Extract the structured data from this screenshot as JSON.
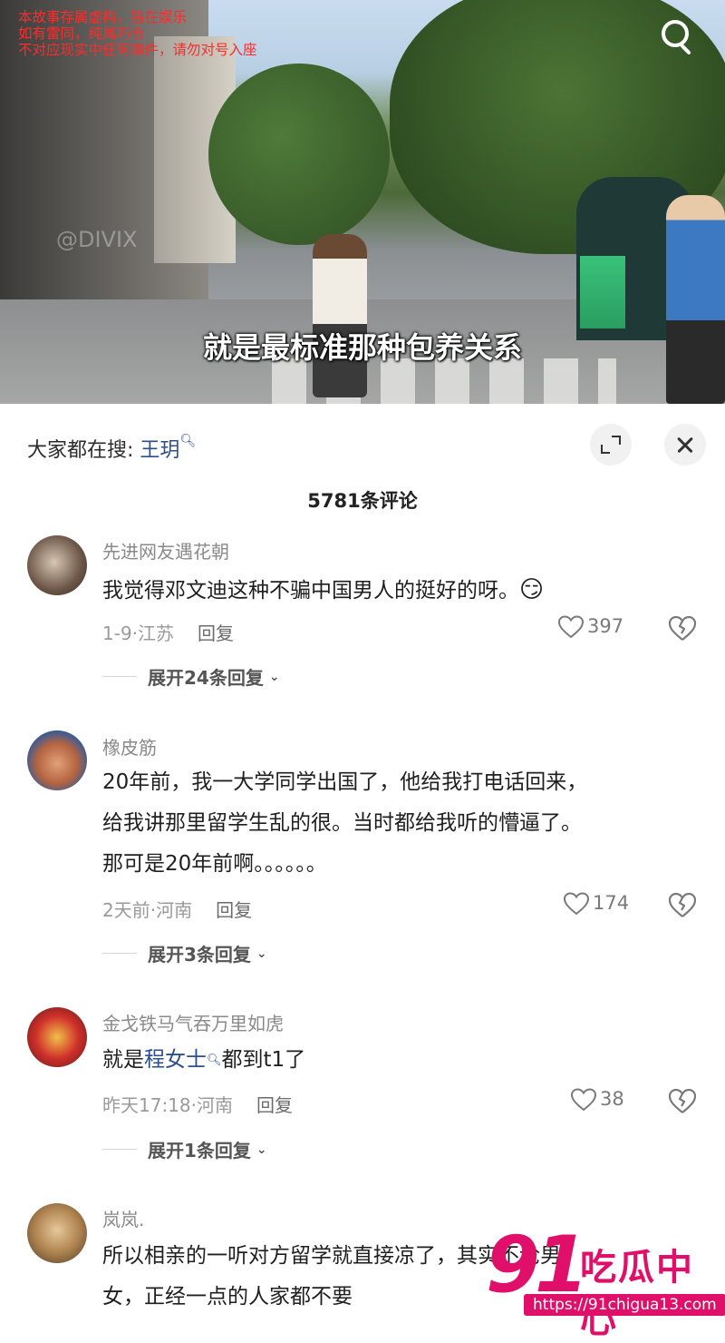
{
  "video": {
    "disclaimer": [
      "本故事存属虚构，旨在娱乐",
      "如有雷同，纯属巧合",
      "不对应现实中任何事件，请勿对号入座"
    ],
    "watermark": "@DIVIX",
    "subtitle": "就是最标准那种包养关系"
  },
  "panel": {
    "hot_search_prefix": "大家都在搜:",
    "hot_search_keyword": "王玥",
    "comment_count": "5781条评论"
  },
  "comments": [
    {
      "username": "先进网友遇花朝",
      "text": "我觉得邓文迪这种不骗中国男人的挺好的呀。",
      "emoji": "😏",
      "meta": "1-9·江苏",
      "reply": "回复",
      "likes": "397",
      "expand": "展开24条回复"
    },
    {
      "username": "橡皮筋",
      "text_lines": [
        "20年前，我一大学同学出国了，他给我打电话回来，",
        "给我讲那里留学生乱的很。当时都给我听的懵逼了。",
        "那可是20年前啊。。。。。。"
      ],
      "meta": "2天前·河南",
      "reply": "回复",
      "likes": "174",
      "expand": "展开3条回复"
    },
    {
      "username": "金戈铁马气吞万里如虎",
      "text_before": "就是",
      "text_keyword": "程女士",
      "text_after": "都到t1了",
      "meta": "昨天17:18·河南",
      "reply": "回复",
      "likes": "38",
      "expand": "展开1条回复"
    },
    {
      "username": "岚岚.",
      "text_lines": [
        "所以相亲的一听对方留学就直接凉了，其实不论男",
        "女，正经一点的人家都不要"
      ]
    }
  ],
  "logo": {
    "number": "91",
    "name": "吃瓜中心",
    "url": "https://91chigua13.com"
  }
}
